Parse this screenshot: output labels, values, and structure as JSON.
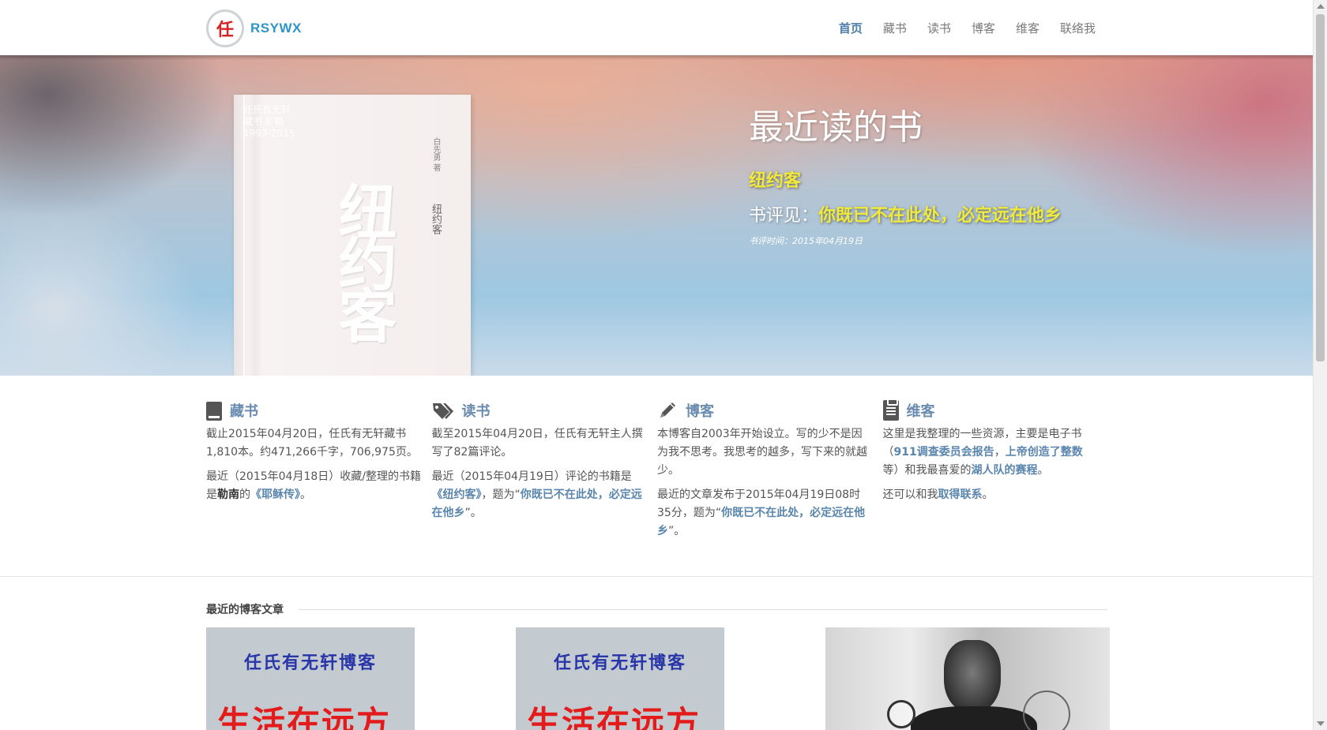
{
  "header": {
    "logo_char": "任",
    "brand": "RSYWX",
    "nav": [
      {
        "label": "首页",
        "active": true
      },
      {
        "label": "藏书",
        "active": false
      },
      {
        "label": "读书",
        "active": false
      },
      {
        "label": "博客",
        "active": false
      },
      {
        "label": "维客",
        "active": false
      },
      {
        "label": "联络我",
        "active": false
      }
    ]
  },
  "hero": {
    "title": "最近读的书",
    "book_name": "纽约客",
    "review_prefix": "书评见：",
    "review_title": "你既已不在此处，必定远在他乡",
    "review_time": "书评时间：2015年04月19日",
    "cover": {
      "top_left_text": "任氏有无轩\n藏书 8 箱\n1993-2015",
      "author": "白先勇 著",
      "title_small": "纽约客",
      "title_big": "纽约客"
    }
  },
  "columns": [
    {
      "icon": "book-icon",
      "title": "藏书",
      "p1": "截止2015年04月20日，任氏有无轩藏书1,810本。约471,266千字，706,975页。",
      "p2_pre": "最近（2015年04月18日）收藏/整理的书籍是",
      "p2_author": "勒南",
      "p2_mid": "的",
      "p2_link": "《耶稣传》",
      "p2_post": "。"
    },
    {
      "icon": "tags-icon",
      "title": "读书",
      "p1": "截至2015年04月20日，任氏有无轩主人撰写了82篇评论。",
      "p2_pre": "最近（2015年04月19日）评论的书籍是",
      "p2_link1": "《纽约客》",
      "p2_mid": "，题为“",
      "p2_link2": "你既已不在此处，必定远在他乡",
      "p2_post": "”。"
    },
    {
      "icon": "pencil-icon",
      "title": "博客",
      "p1": "本博客自2003年开始设立。写的少不是因为我不思考。我思考的越多，写下来的就越少。",
      "p2_pre": "最近的文章发布于2015年04月19日08时35分，题为“",
      "p2_link": "你既已不在此处，必定远在他乡",
      "p2_post": "”。"
    },
    {
      "icon": "clipboard-icon",
      "title": "维客",
      "p1_pre": "这里是我整理的一些资源，主要是电子书（",
      "p1_link1": "911调查委员会报告",
      "p1_sep": "，",
      "p1_link2": "上帝创造了整数",
      "p1_mid": "等）和我最喜爱的",
      "p1_link3": "湖人队的赛程",
      "p1_post": "。",
      "p2_pre": "还可以和我",
      "p2_link": "取得联系",
      "p2_post": "。"
    }
  ],
  "recent": {
    "section_title": "最近的博客文章",
    "cards": [
      {
        "top": "任氏有无轩博客",
        "big": "生活在远方"
      },
      {
        "top": "任氏有无轩博客",
        "big": "生活在远方"
      },
      {
        "type": "photo"
      }
    ]
  }
}
